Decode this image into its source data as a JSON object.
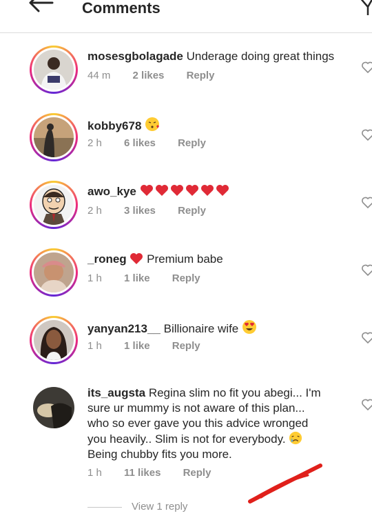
{
  "header": {
    "title": "Comments"
  },
  "colors": {
    "heart": "#e02a36",
    "muted": "#8e8e8e",
    "annotation": "#e0201b"
  },
  "comments": [
    {
      "username": "mosesgbolagade",
      "text": "Underage doing great things",
      "time": "44 m",
      "likes": "2 likes",
      "reply": "Reply"
    },
    {
      "username": "kobby678",
      "text": "",
      "time": "2 h",
      "likes": "6 likes",
      "reply": "Reply",
      "emoji": "kissing-face"
    },
    {
      "username": "awo_kye",
      "text": "",
      "time": "2 h",
      "likes": "3 likes",
      "reply": "Reply",
      "emoji": "six-red-hearts"
    },
    {
      "username": "_roneg",
      "text": "Premium babe",
      "time": "1 h",
      "likes": "1 like",
      "reply": "Reply",
      "emoji": "red-heart"
    },
    {
      "username": "yanyan213__",
      "text": "Billionaire wife",
      "time": "1 h",
      "likes": "1 like",
      "reply": "Reply",
      "emoji": "heart-eyes-face"
    },
    {
      "username": "its_augsta",
      "lines": [
        "Regina slim no fit you abegi... I'm",
        "sure ur mummy is not aware of this plan...",
        "who so ever gave you this advice wronged",
        "you heavily.. Slim is not for everybody.",
        "Being chubby fits you more."
      ],
      "time": "1 h",
      "likes": "11 likes",
      "reply": "Reply",
      "emoji": "crying-face"
    }
  ],
  "view_replies": "View 1 reply"
}
